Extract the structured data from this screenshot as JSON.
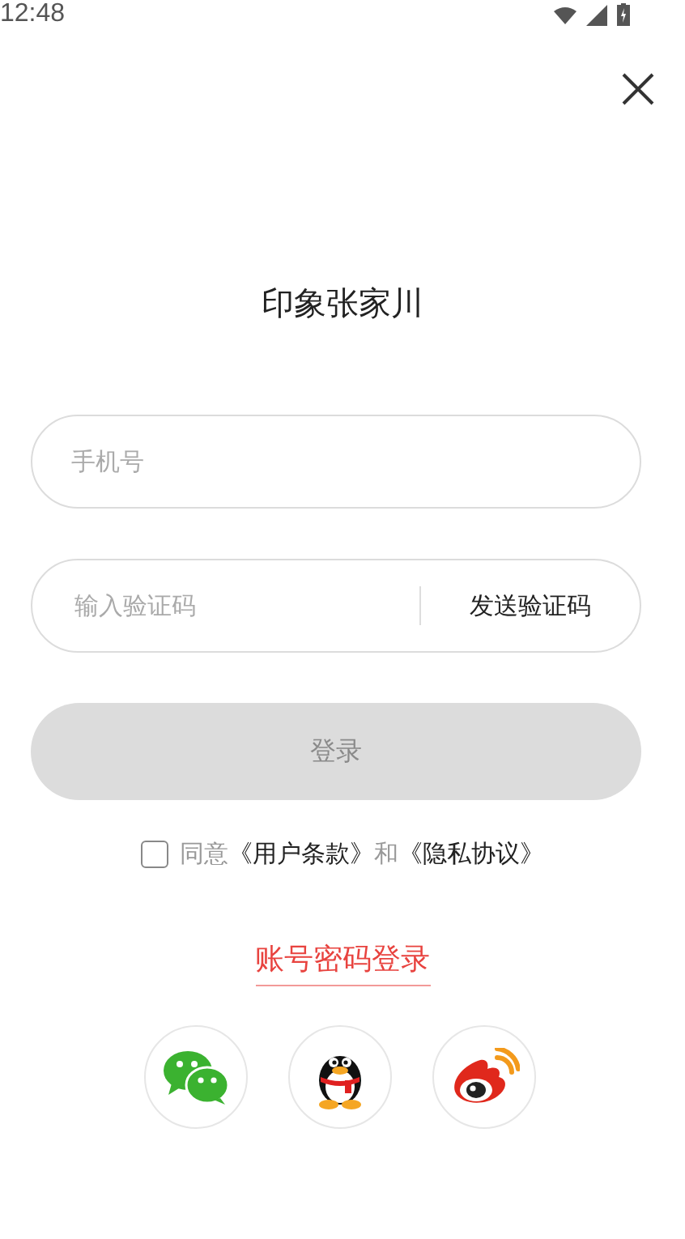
{
  "status_bar": {
    "time": "12:48"
  },
  "title": "印象张家川",
  "phone_field": {
    "placeholder": "手机号"
  },
  "code_field": {
    "placeholder": "输入验证码",
    "send_button": "发送验证码"
  },
  "login_button": {
    "label": "登录",
    "disabled": true
  },
  "agreement": {
    "checked": false,
    "prefix": "同意",
    "terms": "《用户条款》",
    "conjunction": "和",
    "privacy": "《隐私协议》"
  },
  "password_login_link": "账号密码登录",
  "social_logins": [
    {
      "kind": "chat"
    },
    {
      "kind": "penguin"
    },
    {
      "kind": "eye"
    }
  ]
}
